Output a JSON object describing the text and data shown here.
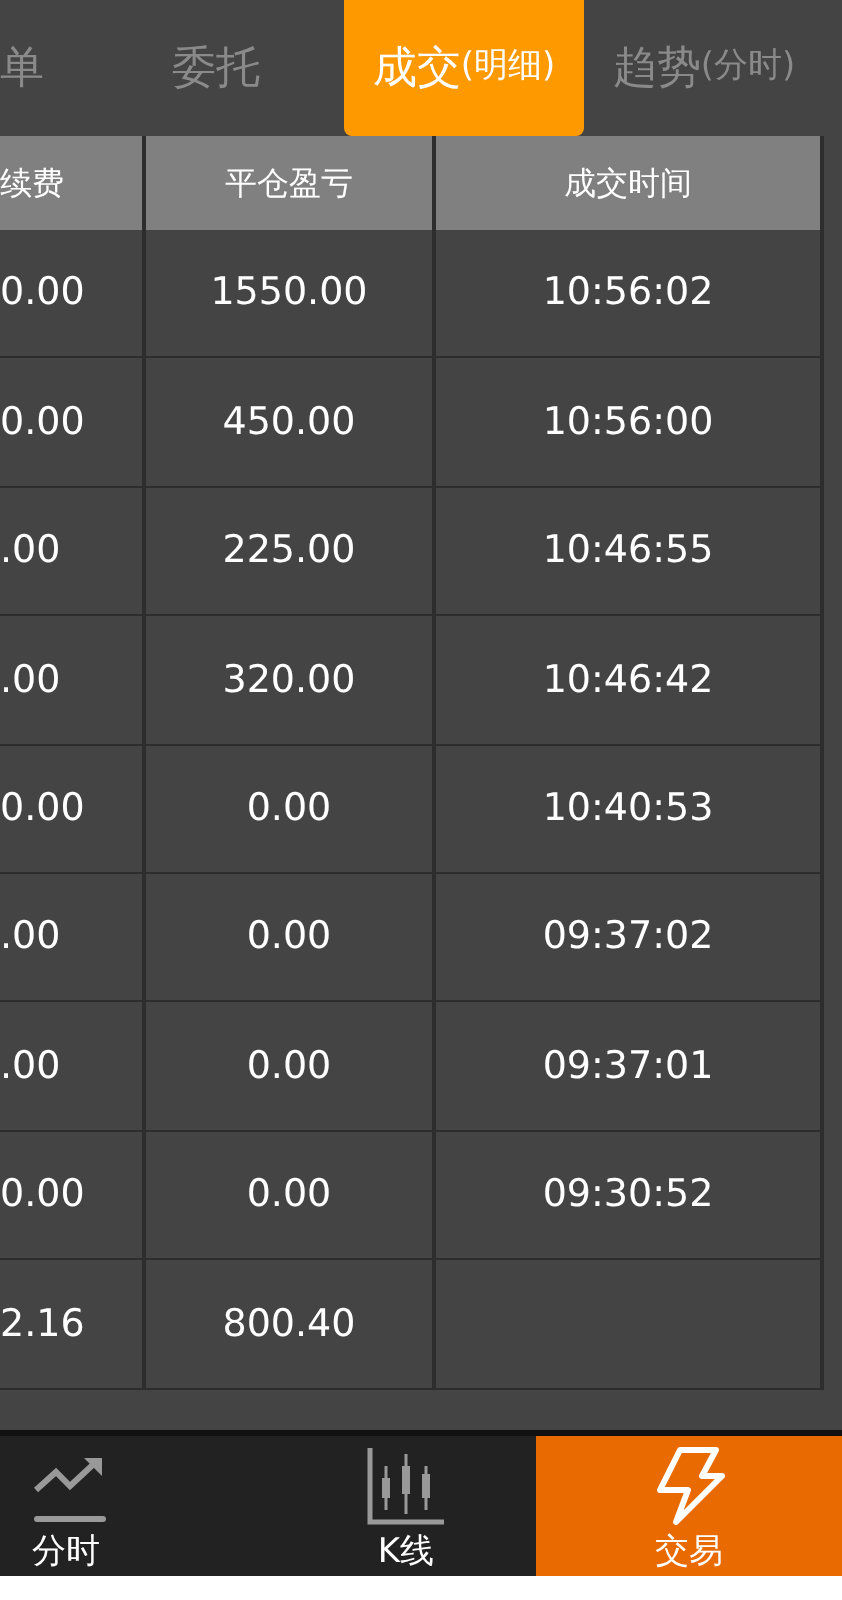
{
  "tabs": [
    {
      "label": "单",
      "selected": false
    },
    {
      "label": "委托",
      "selected": false
    },
    {
      "label": "成交",
      "sub": "(明细)",
      "selected": true
    },
    {
      "label": "趋势",
      "sub": "(分时)",
      "selected": false
    }
  ],
  "table": {
    "columns": [
      "续费",
      "平仓盈亏",
      "成交时间"
    ],
    "rows": [
      [
        "0.00",
        "1550.00",
        "10:56:02"
      ],
      [
        "0.00",
        "450.00",
        "10:56:00"
      ],
      [
        ".00",
        "225.00",
        "10:46:55"
      ],
      [
        ".00",
        "320.00",
        "10:46:42"
      ],
      [
        "0.00",
        "0.00",
        "10:40:53"
      ],
      [
        ".00",
        "0.00",
        "09:37:02"
      ],
      [
        ".00",
        "0.00",
        "09:37:01"
      ],
      [
        "0.00",
        "0.00",
        "09:30:52"
      ],
      [
        "2.16",
        "800.40"
      ]
    ]
  },
  "bottom_nav": [
    {
      "label": "分时",
      "kind": "trend",
      "selected": false
    },
    {
      "label": "K线",
      "kind": "candles",
      "selected": false
    },
    {
      "label": "交易",
      "kind": "bolt",
      "selected": true
    }
  ]
}
